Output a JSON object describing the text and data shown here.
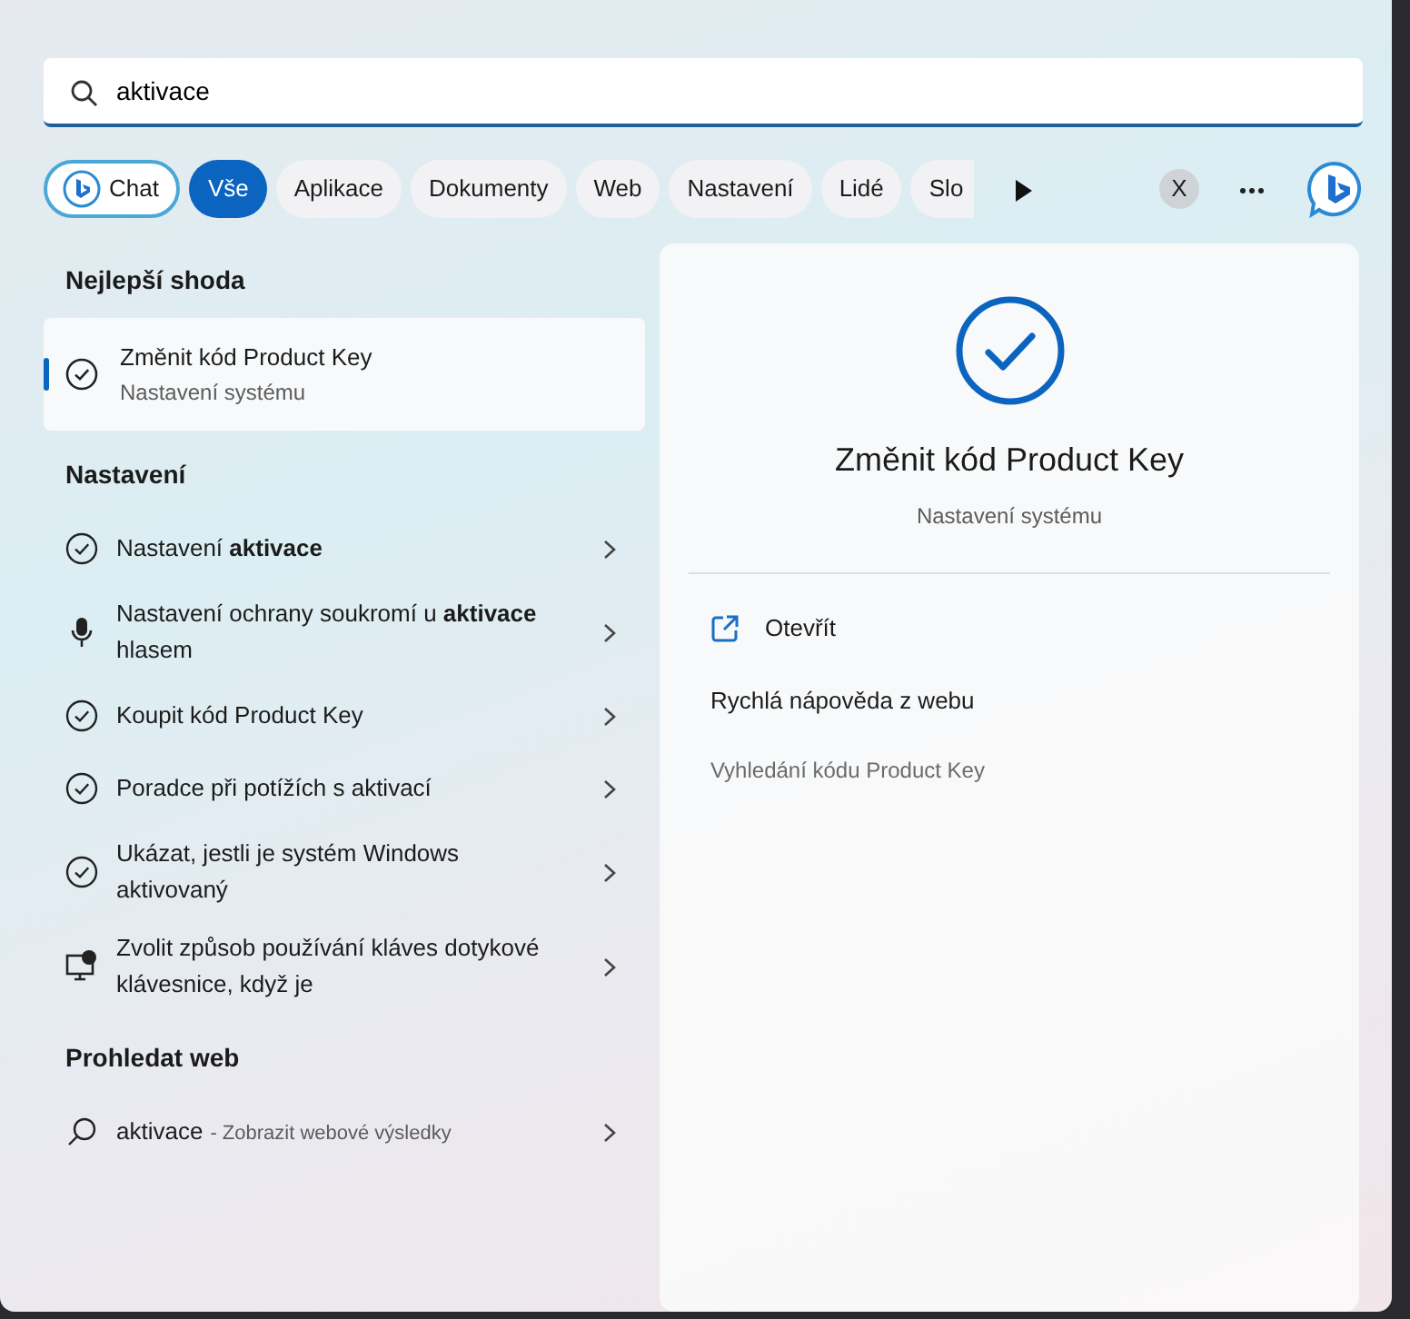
{
  "search": {
    "value": "aktivace"
  },
  "filters": [
    {
      "label": "Chat",
      "kind": "chat",
      "selected": false
    },
    {
      "label": "Vše",
      "kind": "chip",
      "selected": true
    },
    {
      "label": "Aplikace",
      "kind": "chip",
      "selected": false
    },
    {
      "label": "Dokumenty",
      "kind": "chip",
      "selected": false
    },
    {
      "label": "Web",
      "kind": "chip",
      "selected": false
    },
    {
      "label": "Nastavení",
      "kind": "chip",
      "selected": false
    },
    {
      "label": "Lidé",
      "kind": "chip",
      "selected": false
    },
    {
      "label": "Slo",
      "kind": "chip",
      "selected": false
    }
  ],
  "account_initial": "X",
  "best_match": {
    "heading": "Nejlepší shoda",
    "title": "Změnit kód Product Key",
    "subtitle": "Nastavení systému",
    "selected": true
  },
  "settings": {
    "heading": "Nastavení",
    "items": [
      {
        "kind": "check",
        "text": "Nastavení **aktivace**"
      },
      {
        "kind": "mic",
        "text": "Nastavení ochrany soukromí u **aktivace** hlasem"
      },
      {
        "kind": "check",
        "text": "Koupit kód Product Key"
      },
      {
        "kind": "check",
        "text": "Poradce při potížích s aktivací"
      },
      {
        "kind": "check",
        "text": "Ukázat, jestli je systém Windows aktivovaný"
      },
      {
        "kind": "touch",
        "text": "Zvolit způsob používání kláves dotykové klávesnice, když je"
      }
    ]
  },
  "web": {
    "heading": "Prohledat web",
    "query": "aktivace",
    "suffix": "- Zobrazit webové výsledky"
  },
  "preview": {
    "title": "Změnit kód Product Key",
    "subtitle": "Nastavení systému",
    "action": "Otevřít",
    "help_heading": "Rychlá nápověda z webu",
    "links": [
      "Vyhledání kódu Product Key"
    ]
  }
}
